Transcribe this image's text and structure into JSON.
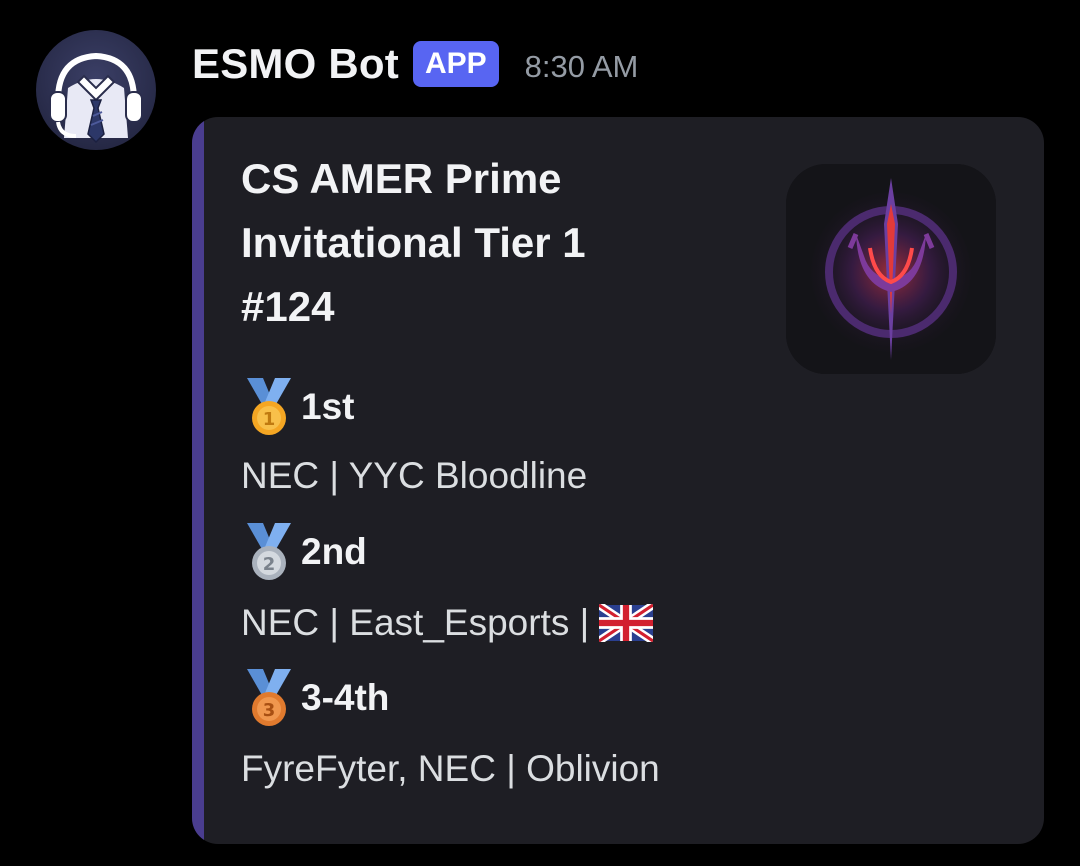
{
  "author": {
    "name": "ESMO Bot",
    "badge": "APP",
    "timestamp": "8:30 AM",
    "avatar_icon": "bot-butler-headset-icon"
  },
  "embed": {
    "accent_color": "#4a3d8f",
    "title_lines": [
      "CS AMER Prime",
      "Invitational Tier 1",
      "#124"
    ],
    "thumbnail_icon": "trident-logo-icon",
    "placements": [
      {
        "medal": "gold-medal-icon",
        "place": "1st",
        "teams": "NEC | YYC Bloodline",
        "flag": ""
      },
      {
        "medal": "silver-medal-icon",
        "place": "2nd",
        "teams": "NEC | East_Esports |",
        "flag": "uk-flag-icon"
      },
      {
        "medal": "bronze-medal-icon",
        "place": "3-4th",
        "teams": "FyreFyter, NEC | Oblivion",
        "flag": ""
      }
    ]
  },
  "colors": {
    "background": "#000000",
    "embed_bg": "#1e1e24",
    "app_badge": "#5865f2",
    "timestamp": "#949ba4"
  }
}
